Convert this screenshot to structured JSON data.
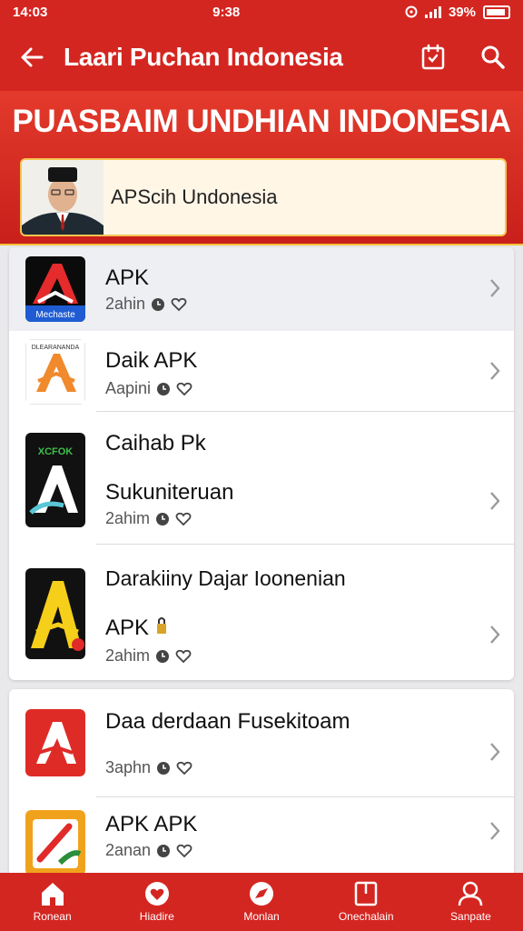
{
  "status": {
    "time": "14:03",
    "clock": "9:38",
    "battery": "39%"
  },
  "appbar": {
    "title": "Laari Puchan Indonesia"
  },
  "banner": {
    "title": "PUASBAIM UNDHIAN INDONESIA",
    "promo_text": "APScih Undonesia"
  },
  "list_one": [
    {
      "title": "APK",
      "subtitle": "",
      "meta": "2ahin",
      "icon_label": "Mechaste",
      "icon_label_top": ""
    },
    {
      "title": "Daik APK",
      "subtitle": "",
      "meta": "Aapini",
      "icon_label": "",
      "icon_label_top": "DLEARANANDA"
    },
    {
      "title": "Caihab Pk",
      "subtitle": "Sukuniteruan",
      "meta": "2ahim",
      "icon_label": "",
      "icon_label_top": "XCFOK"
    },
    {
      "title": "Darakiiny Dajar Ioonenian",
      "subtitle": "APK",
      "meta": "2ahim",
      "icon_label": "",
      "icon_label_top": ""
    }
  ],
  "list_two": [
    {
      "title": "Daa derdaan Fusekitoam",
      "subtitle": "",
      "meta": "3aphn"
    },
    {
      "title": "APK APK",
      "subtitle": "",
      "meta": "2anan"
    }
  ],
  "nav": [
    {
      "label": "Ronean",
      "icon": "home-icon"
    },
    {
      "label": "Hiadire",
      "icon": "heart-icon"
    },
    {
      "label": "Monlan",
      "icon": "compass-icon"
    },
    {
      "label": "Onechalain",
      "icon": "book-icon"
    },
    {
      "label": "Sanpate",
      "icon": "user-icon"
    }
  ],
  "colors": {
    "brand": "#d42621",
    "accent": "#f3c23a"
  }
}
